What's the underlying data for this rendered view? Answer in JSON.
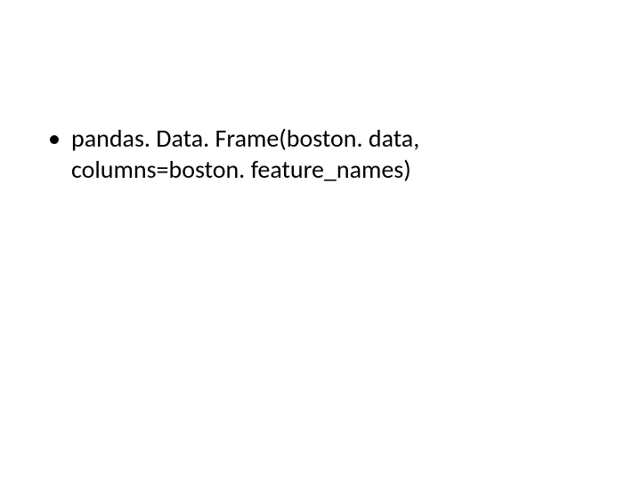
{
  "slide": {
    "bullets": [
      {
        "line1": "pandas. Data. Frame(boston. data,",
        "line2": "columns=boston. feature_names)"
      }
    ]
  }
}
